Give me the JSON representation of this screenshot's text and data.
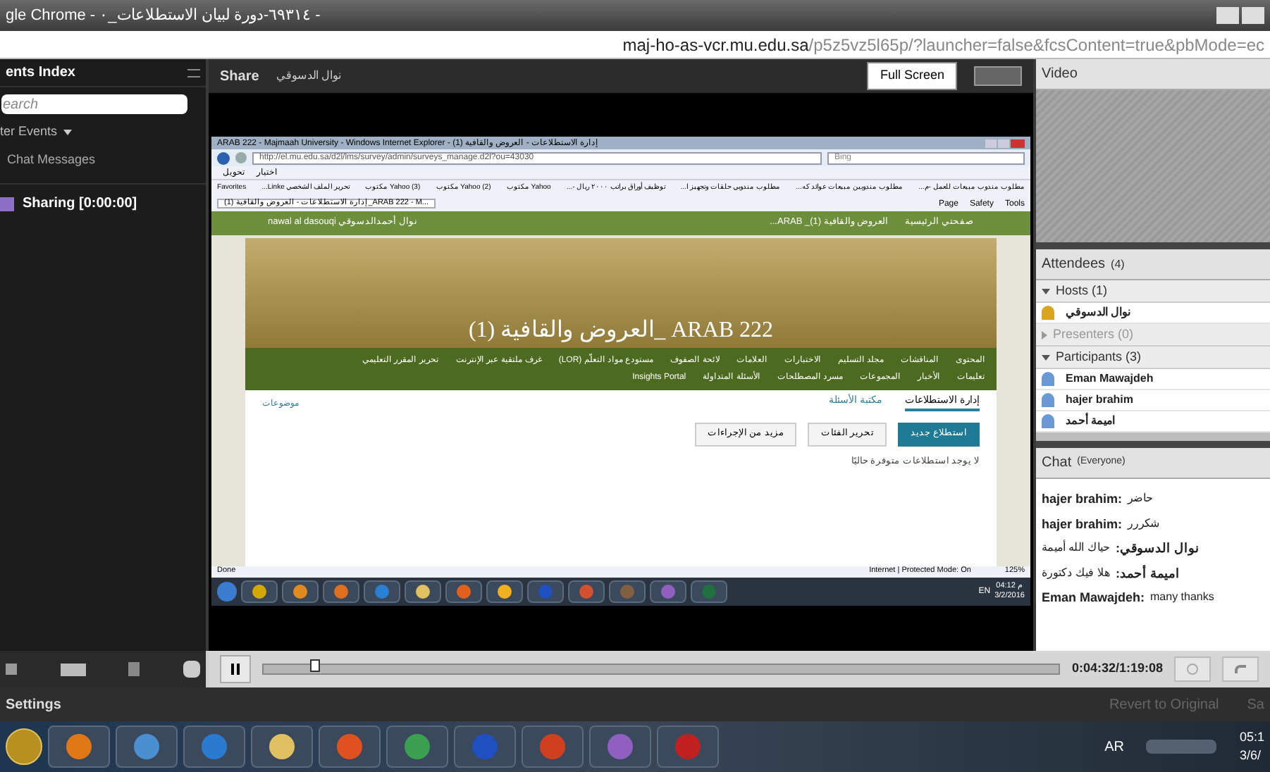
{
  "browser": {
    "title": "gle Chrome - ٦٩٣١٤-دورة لبيان الاستطلاعات_٠ -",
    "url_host": "maj-ho-as-vcr.mu.edu.sa",
    "url_path": "/p5z5vz5l65p/?launcher=false&fcsContent=true&pbMode=ec"
  },
  "events_index": {
    "title": "ents Index",
    "search": {
      "placeholder": "earch"
    },
    "filter": "ter Events",
    "filter_items": [
      "Chat Messages"
    ],
    "events": [
      "Sharing [0:00:00]"
    ]
  },
  "share_pod": {
    "title": "Share",
    "presenter": "نوال الدسوقي",
    "full_screen": "Full Screen"
  },
  "shared_screen": {
    "ie": {
      "title": "ARAB 222 - Majmaah University - Windows Internet Explorer - إدارة الاستطلاعات - العروض والقافية (1)",
      "url": "http://el.mu.edu.sa/d2l/lms/survey/admin/surveys_manage.d2l?ou=43030",
      "search_placeholder": "Bing",
      "command_bar": [
        "اختيار",
        "تحويل"
      ],
      "favorites": [
        "مطلوب مندوب مبيعات للعمل -م...",
        "مطلوب مندوبين مبيعات عوائد كه...",
        "مطلوب مندوبي حلقات وتجهيز ا...",
        "توظيف أوراق براتب ٢٠٠٠ ريال -...",
        "Yahoo مكتوب",
        "Yahoo (2) مكتوب",
        "Yahoo (3) مكتوب",
        "تحرير الملف الشخصي Linke...",
        "Favorites"
      ],
      "tab": "إدارة الاستطلاعات - العروض والقافية (1)_ARAB 222 - M...",
      "tools": [
        "Tools",
        "Safety",
        "Page"
      ],
      "status": "Done",
      "zone": "Internet | Protected Mode: On",
      "zoom": "125%"
    },
    "site": {
      "user": "nawal al dasouqi نوال أحمدالدسوقي",
      "breadcrumb": [
        "صفحتي الرئيسية",
        "العروض والقافية (1)_ ARAB..."
      ],
      "course_title": "العروض والقافية (1)_ ARAB 222",
      "menu_rows": [
        [
          "المحتوى",
          "المناقشات",
          "مجلد التسليم",
          "الاختبارات",
          "العلامات",
          "لائحة الصفوف",
          "مستودع مواد التعلّم (LOR)",
          "غرف ملتقية عبر الإنترنت",
          "تحرير المقرر التعليمي"
        ],
        [
          "تعليمات",
          "الأخبار",
          "المجموعات",
          "مسرد المصطلحات",
          "الأسئلة المتداولة",
          "Insights Portal"
        ]
      ],
      "tabs": [
        {
          "label": "إدارة الاستطلاعات",
          "selected": true
        },
        {
          "label": "مكتبة الأسئلة",
          "selected": false
        }
      ],
      "help": "موضوعات",
      "buttons": [
        "استطلاع جديد",
        "تحرير الفئات",
        "مزيد من الإجراءات"
      ],
      "empty": "لا يوجد استطلاعات متوفرة حاليًا"
    },
    "taskbar": {
      "lang": "EN",
      "time": "04:12 م",
      "date": "3/2/2016"
    }
  },
  "video_pod": {
    "title": "Video"
  },
  "attendees": {
    "title": "Attendees",
    "count": "(4)",
    "groups": [
      {
        "label": "Hosts (1)",
        "expanded": true,
        "members": [
          {
            "name": "نوال الدسوقي",
            "kind": "host"
          }
        ]
      },
      {
        "label": "Presenters (0)",
        "expanded": false
      },
      {
        "label": "Participants (3)",
        "expanded": true,
        "members": [
          {
            "name": "Eman Mawajdeh",
            "kind": "participant"
          },
          {
            "name": "hajer brahim",
            "kind": "participant"
          },
          {
            "name": "اميمة أحمد",
            "kind": "participant"
          }
        ]
      }
    ]
  },
  "chat": {
    "title": "Chat",
    "scope": "(Everyone)",
    "messages": [
      {
        "sender": "hajer brahim:",
        "text": "حاضر",
        "rtl": false
      },
      {
        "sender": "hajer brahim:",
        "text": "شكررر",
        "rtl": false
      },
      {
        "sender": "نوال الدسوقي:",
        "text": "حياك الله أميمة",
        "rtl": true
      },
      {
        "sender": "اميمة أحمد:",
        "text": "هلا فيك دكتورة",
        "rtl": true
      },
      {
        "sender": "Eman Mawajdeh:",
        "text": "many thanks",
        "rtl": false
      }
    ]
  },
  "playback": {
    "playing": true,
    "level": 0.058,
    "time": "0:04:32/1:19:08"
  },
  "settings_bar": {
    "title": "Settings",
    "revert": "Revert to Original",
    "save": "Sa"
  },
  "taskbar": {
    "lang": "AR",
    "time": "05:1",
    "date": "3/6/"
  }
}
